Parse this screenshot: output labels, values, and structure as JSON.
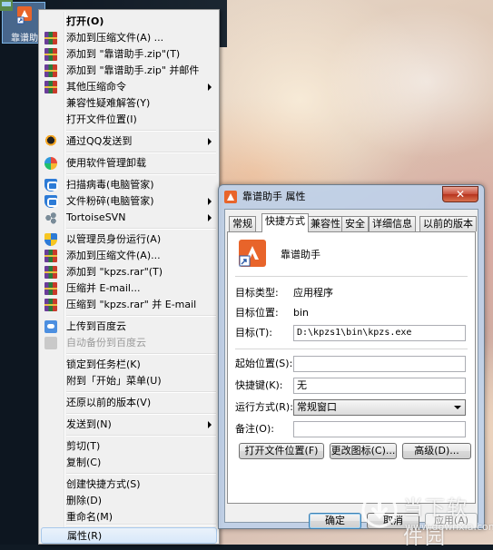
{
  "desktop": {
    "icon_label": "靠谱助"
  },
  "context_menu": {
    "items": [
      {
        "label": "打开(O)",
        "bold": true,
        "icon": "none"
      },
      {
        "label": "添加到压缩文件(A) ...",
        "icon": "winrar-icon"
      },
      {
        "label": "添加到 \"靠谱助手.zip\"(T)",
        "icon": "winrar-icon"
      },
      {
        "label": "添加到 \"靠谱助手.zip\" 并邮件",
        "icon": "winrar-icon"
      },
      {
        "label": "其他压缩命令",
        "icon": "winrar-icon",
        "submenu": true
      },
      {
        "label": "兼容性疑难解答(Y)",
        "icon": "none"
      },
      {
        "label": "打开文件位置(I)",
        "icon": "none"
      },
      {
        "label": "通过QQ发送到",
        "icon": "qq-icon",
        "submenu": true
      },
      {
        "label": "使用软件管理卸载",
        "icon": "software-manager-icon"
      },
      {
        "label": "扫描病毒(电脑管家)",
        "icon": "tencent-shield-icon"
      },
      {
        "label": "文件粉碎(电脑管家)",
        "icon": "tencent-shield-icon",
        "submenu": true
      },
      {
        "label": "TortoiseSVN",
        "icon": "tortoisesvn-icon",
        "submenu": true
      },
      {
        "label": "以管理员身份运行(A)",
        "icon": "uac-shield-icon"
      },
      {
        "label": "添加到压缩文件(A)...",
        "icon": "winrar-icon"
      },
      {
        "label": "添加到 \"kpzs.rar\"(T)",
        "icon": "winrar-icon"
      },
      {
        "label": "压缩并 E-mail...",
        "icon": "winrar-icon"
      },
      {
        "label": "压缩到 \"kpzs.rar\" 并 E-mail",
        "icon": "winrar-icon"
      },
      {
        "label": "上传到百度云",
        "icon": "baidu-cloud-icon"
      },
      {
        "label": "自动备份到百度云",
        "icon": "baidu-cloud-icon",
        "disabled": true
      },
      {
        "label": "锁定到任务栏(K)",
        "icon": "none"
      },
      {
        "label": "附到「开始」菜单(U)",
        "icon": "none"
      },
      {
        "label": "还原以前的版本(V)",
        "icon": "none"
      },
      {
        "label": "发送到(N)",
        "icon": "none",
        "submenu": true
      },
      {
        "label": "剪切(T)",
        "icon": "none"
      },
      {
        "label": "复制(C)",
        "icon": "none"
      },
      {
        "label": "创建快捷方式(S)",
        "icon": "none"
      },
      {
        "label": "删除(D)",
        "icon": "none"
      },
      {
        "label": "重命名(M)",
        "icon": "none"
      },
      {
        "label": "属性(R)",
        "icon": "none",
        "highlighted": true
      }
    ]
  },
  "dialog": {
    "title": "靠谱助手 属性",
    "close_label": "✕",
    "tabs": [
      "常规",
      "快捷方式",
      "兼容性",
      "安全",
      "详细信息",
      "以前的版本"
    ],
    "active_tab": "快捷方式",
    "app_name": "靠谱助手",
    "fields": {
      "type_label": "目标类型:",
      "type_value": "应用程序",
      "location_label": "目标位置:",
      "location_value": "bin",
      "target_label": "目标(T):",
      "target_value": "D:\\kpzs1\\bin\\kpzs.exe",
      "start_in_label": "起始位置(S):",
      "start_in_value": "",
      "shortcut_key_label": "快捷键(K):",
      "shortcut_key_value": "无",
      "run_label": "运行方式(R):",
      "run_value": "常规窗口",
      "comment_label": "备注(O):",
      "comment_value": ""
    },
    "buttons": {
      "open_location": "打开文件位置(F)",
      "change_icon": "更改图标(C)...",
      "advanced": "高级(D)...",
      "ok": "确定",
      "cancel": "取消",
      "apply": "应用(A)"
    }
  },
  "watermark": {
    "name": "当下软件园",
    "url": "www.downxia.com"
  },
  "colors": {
    "menu_bg": "#f0f0f0",
    "highlight": "#d8e8f9",
    "app_icon_orange": "#e8642a"
  }
}
